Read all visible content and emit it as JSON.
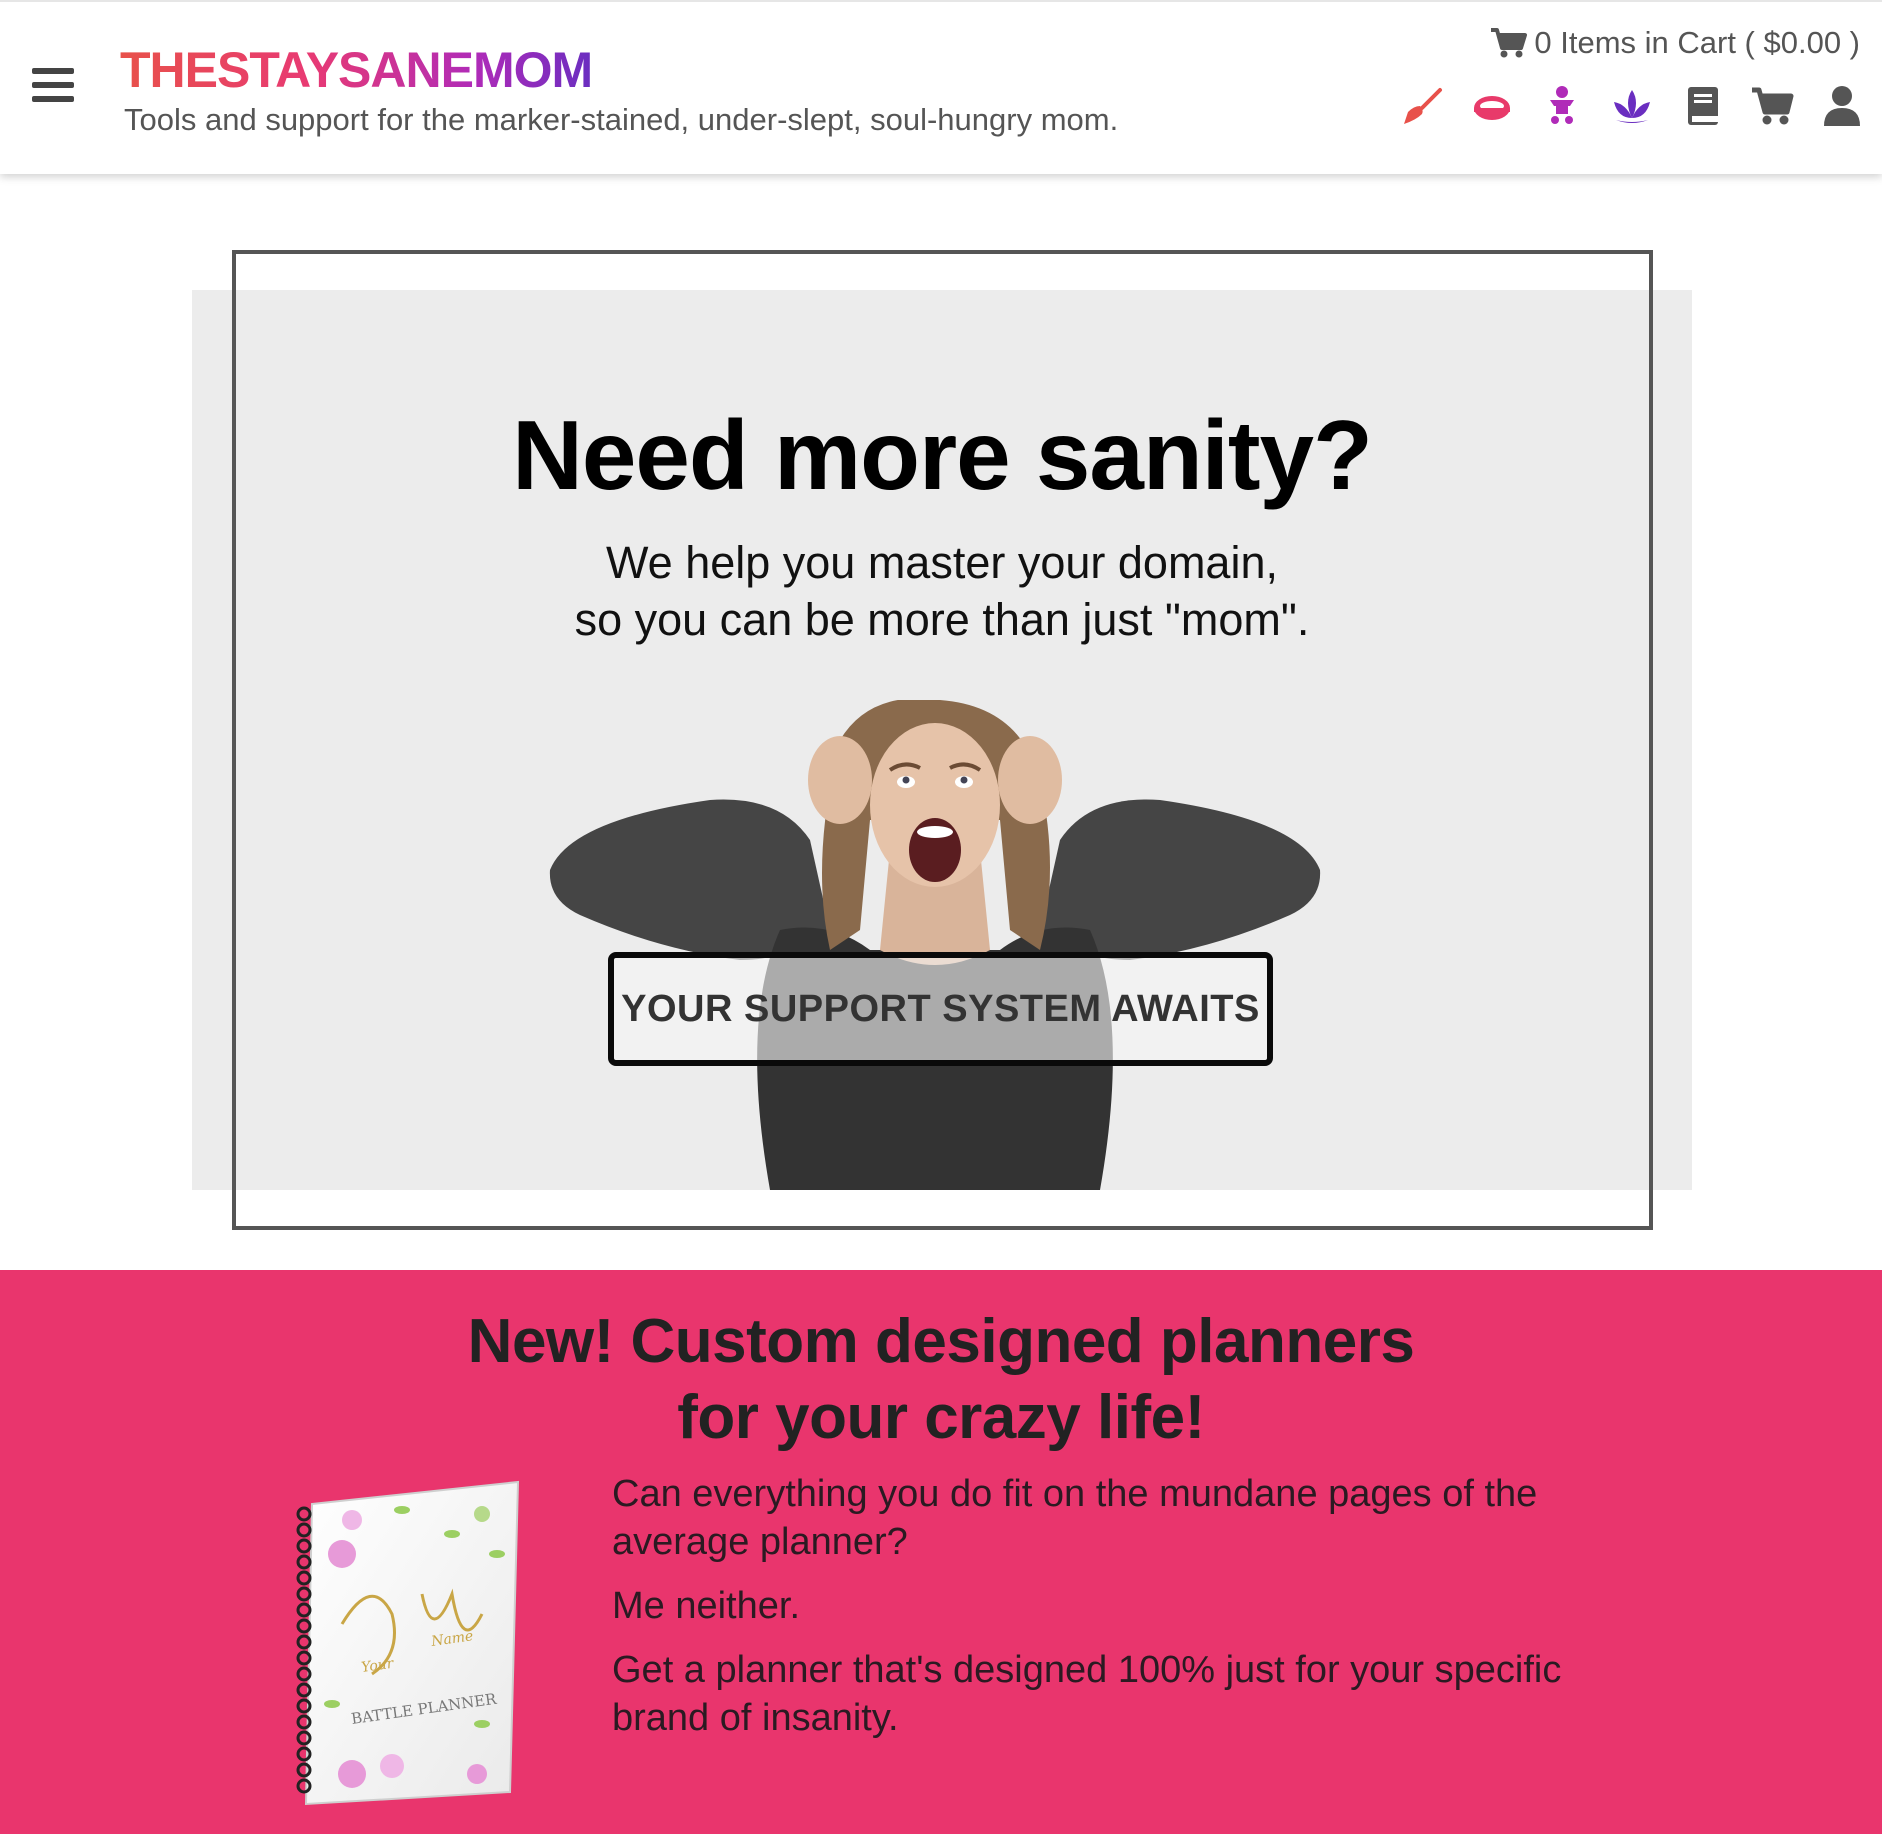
{
  "header": {
    "logo_text": "THESTAYSANEMOM",
    "tagline": "Tools and support for the marker-stained, under-slept, soul-hungry mom.",
    "cart_summary": "0 Items in Cart ( $0.00 )",
    "nav_icons": [
      {
        "name": "broom-icon",
        "color": "#e8514a"
      },
      {
        "name": "ring-icon",
        "color": "#e83a6a"
      },
      {
        "name": "baby-icon",
        "color": "#b02bb8"
      },
      {
        "name": "lotus-icon",
        "color": "#6a2ec0"
      },
      {
        "name": "book-icon",
        "color": "#555555"
      },
      {
        "name": "cart-icon",
        "color": "#555555"
      },
      {
        "name": "user-icon",
        "color": "#555555"
      }
    ]
  },
  "hero": {
    "title": "Need more sanity?",
    "subtitle_line1": "We help you master your domain,",
    "subtitle_line2": "so you can be more than just \"mom\".",
    "cta_label": "YOUR SUPPORT SYSTEM AWAITS"
  },
  "planner": {
    "heading_line1": "New! Custom designed planners",
    "heading_line2": "for your crazy life!",
    "paragraphs": [
      "Can everything you do fit on the mundane pages of the average planner?",
      "Me neither.",
      "Get a planner that's designed 100% just for your specific brand of insanity."
    ],
    "book_script": "Your Name",
    "book_title": "Battle Planner"
  },
  "colors": {
    "accent_pink": "#e9356d",
    "hero_bg": "#ececec",
    "logo_gradient": [
      "#e8514a",
      "#e83a73",
      "#b02bb8",
      "#6a2ec0"
    ]
  }
}
